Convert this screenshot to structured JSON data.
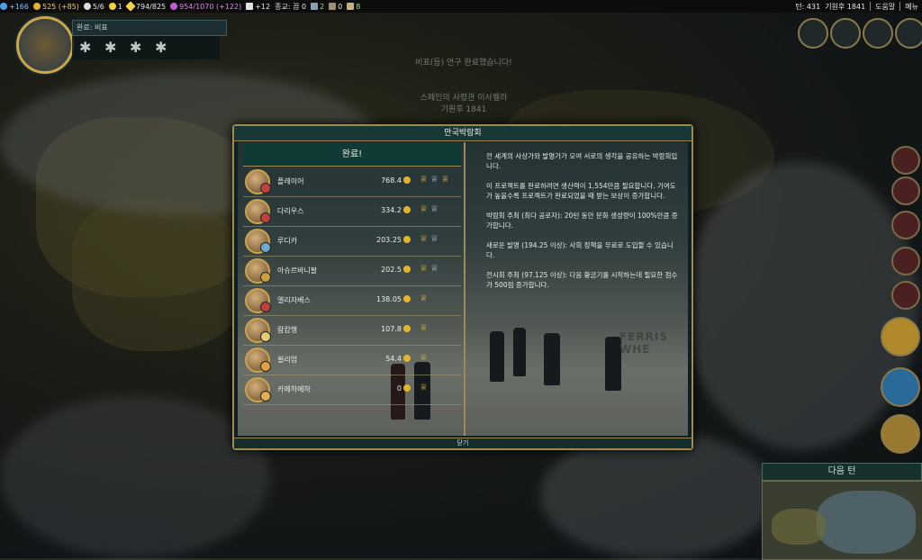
{
  "topbar": {
    "science": "+166",
    "gold": "525 (+85)",
    "trade_routes": "5/6",
    "happiness": "1",
    "culture": "794/825",
    "tourism": "954/1070 (+122)",
    "faith": "+12",
    "religion": "종교: 끔 0",
    "res1": "2",
    "res2": "0",
    "res3": "8",
    "turn": "턴: 431",
    "year": "기원후 1841",
    "help_label": "도움말",
    "menu_label": "메뉴"
  },
  "empire": {
    "wonder_strip_label": "완료: 비표",
    "stars": [
      "star",
      "star",
      "star",
      "star"
    ]
  },
  "background_banner": {
    "line1": "비표(등) 연구 완료했습니다!",
    "line2": "스페인의 사령관 이사벨라",
    "line3": "기원후 1841"
  },
  "dialog": {
    "title": "만국박람회",
    "header": "완료!",
    "close_label": "닫기",
    "ranking": [
      {
        "name": "플레이어",
        "score": "768.4",
        "trophies": [
          "gold",
          "silver",
          "gold"
        ]
      },
      {
        "name": "다리우스",
        "score": "334.2",
        "trophies": [
          "gold",
          "silver"
        ]
      },
      {
        "name": "루디카",
        "score": "203.25",
        "trophies": [
          "gold",
          "silver"
        ]
      },
      {
        "name": "아슈르바니팔",
        "score": "202.5",
        "trophies": [
          "gold",
          "silver"
        ]
      },
      {
        "name": "엘리자베스",
        "score": "138.05",
        "trophies": [
          "gold"
        ]
      },
      {
        "name": "람캄행",
        "score": "107.8",
        "trophies": [
          "gold"
        ]
      },
      {
        "name": "윌리엄",
        "score": "54.4",
        "trophies": [
          "gold"
        ]
      },
      {
        "name": "카메하메하",
        "score": "0",
        "trophies": [
          "gold"
        ]
      }
    ],
    "description": [
      "전 세계의 사상가와 발명가가 모여 서로의 생각을 공유하는 박람회입니다.",
      "이 프로젝트를 완료하려면 생산력이 1,554만큼 필요합니다. 기여도가 높을수록 프로젝트가 완료되었을 때 받는 보상이 증가합니다.",
      "박람회 주최 (최다 공로자): 20턴 동안 문화 생성량이 100%만큼 증가합니다.",
      "새로운 발명 (194.25 이상): 사회 정책을 무료로 도입할 수 있습니다.",
      "전시회 주최 (97.125 이상): 다음 황금기를 시작하는데 필요한 점수가 500점 증가합니다."
    ],
    "photo_sign": "FERRIS WHE"
  },
  "sidebar": {
    "next_turn_label": "다음 턴"
  },
  "colors": {
    "frame_gold": "#9e8a55",
    "panel_teal": "#0f3a36",
    "coin": "#e3b52a"
  }
}
